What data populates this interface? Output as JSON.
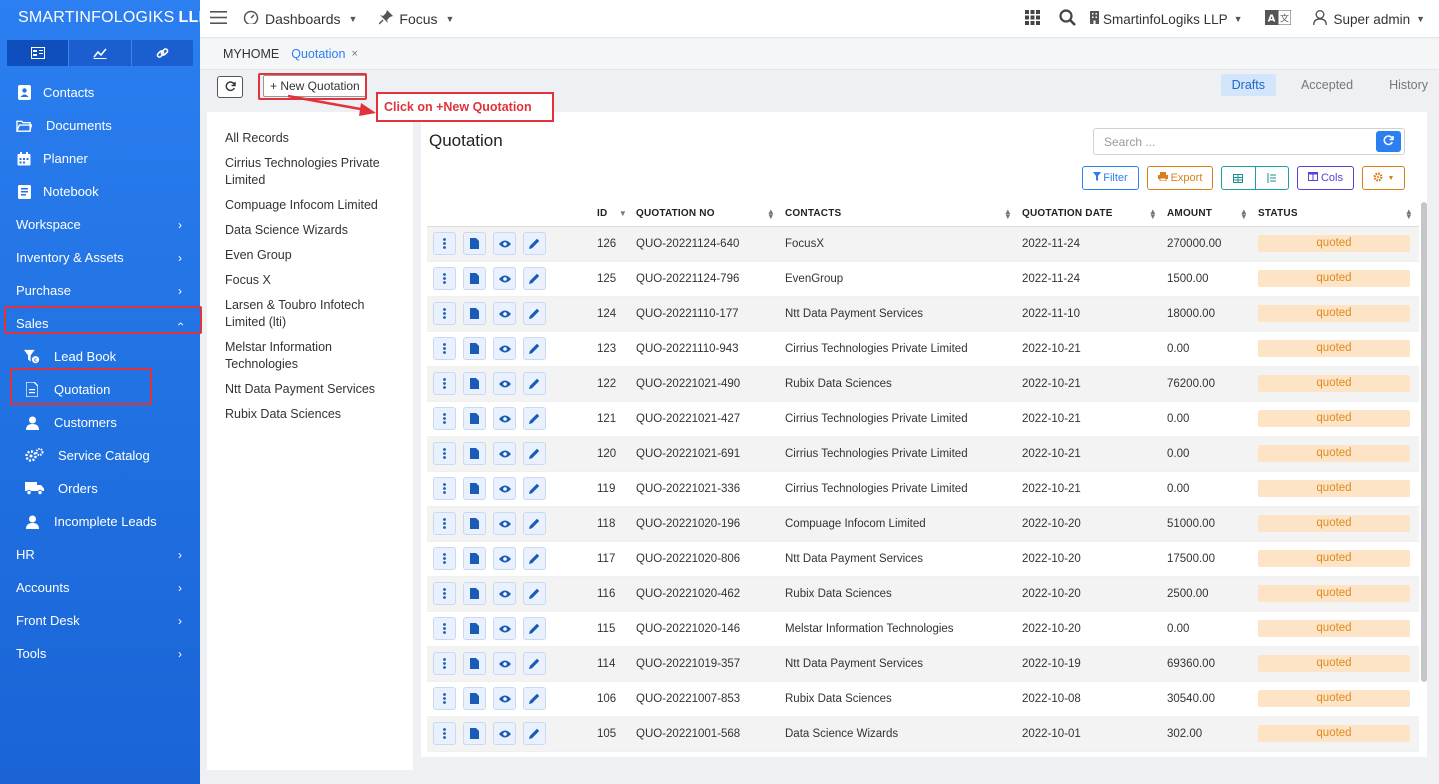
{
  "brand": {
    "name": "SMARTINFOLOGIKS",
    "suffix": "LLP"
  },
  "sidebar": {
    "items": [
      {
        "label": "Contacts",
        "icon": "contact-icon"
      },
      {
        "label": "Documents",
        "icon": "folder-icon"
      },
      {
        "label": "Planner",
        "icon": "calendar-icon"
      },
      {
        "label": "Notebook",
        "icon": "notebook-icon"
      },
      {
        "label": "Workspace",
        "icon": ""
      },
      {
        "label": "Inventory & Assets",
        "icon": ""
      },
      {
        "label": "Purchase",
        "icon": ""
      },
      {
        "label": "Sales",
        "icon": ""
      }
    ],
    "sales_sub": [
      {
        "label": "Lead Book",
        "icon": "lead-filter-icon"
      },
      {
        "label": "Quotation",
        "icon": "document-icon"
      },
      {
        "label": "Customers",
        "icon": "user-icon"
      },
      {
        "label": "Service Catalog",
        "icon": "gears-icon"
      },
      {
        "label": "Orders",
        "icon": "truck-icon"
      },
      {
        "label": "Incomplete Leads",
        "icon": "user-icon"
      }
    ],
    "bottom": [
      {
        "label": "HR"
      },
      {
        "label": "Accounts"
      },
      {
        "label": "Front Desk"
      },
      {
        "label": "Tools"
      }
    ]
  },
  "topbar": {
    "dashboards": "Dashboards",
    "focus": "Focus",
    "company": "SmartinfoLogiks LLP",
    "user": "Super admin"
  },
  "breadcrumb": {
    "home": "MYHOME",
    "current": "Quotation",
    "close": "×"
  },
  "actions": {
    "new_label": "+ New Quotation"
  },
  "tabs": [
    "Drafts",
    "Accepted",
    "History"
  ],
  "callout": "Click on +New Quotation",
  "filters": [
    "All Records",
    "Cirrius Technologies Private Limited",
    "Compuage Infocom Limited",
    "Data Science Wizards",
    "Even Group",
    "Focus X",
    "Larsen & Toubro Infotech Limited (lti)",
    "Melstar Information Technologies",
    "Ntt Data Payment Services",
    "Rubix Data Sciences"
  ],
  "main": {
    "title": "Quotation",
    "search_placeholder": "Search ...",
    "buttons": {
      "filter": "Filter",
      "export": "Export",
      "cols": "Cols"
    }
  },
  "table": {
    "headers": [
      "ID",
      "QUOTATION NO",
      "CONTACTS",
      "QUOTATION DATE",
      "AMOUNT",
      "STATUS"
    ],
    "rows": [
      [
        "126",
        "QUO-20221124-640",
        "FocusX",
        "2022-11-24",
        "270000.00",
        "quoted"
      ],
      [
        "125",
        "QUO-20221124-796",
        "EvenGroup",
        "2022-11-24",
        "1500.00",
        "quoted"
      ],
      [
        "124",
        "QUO-20221110-177",
        "Ntt Data Payment Services",
        "2022-11-10",
        "18000.00",
        "quoted"
      ],
      [
        "123",
        "QUO-20221110-943",
        "Cirrius Technologies Private Limited",
        "2022-10-21",
        "0.00",
        "quoted"
      ],
      [
        "122",
        "QUO-20221021-490",
        "Rubix Data Sciences",
        "2022-10-21",
        "76200.00",
        "quoted"
      ],
      [
        "121",
        "QUO-20221021-427",
        "Cirrius Technologies Private Limited",
        "2022-10-21",
        "0.00",
        "quoted"
      ],
      [
        "120",
        "QUO-20221021-691",
        "Cirrius Technologies Private Limited",
        "2022-10-21",
        "0.00",
        "quoted"
      ],
      [
        "119",
        "QUO-20221021-336",
        "Cirrius Technologies Private Limited",
        "2022-10-21",
        "0.00",
        "quoted"
      ],
      [
        "118",
        "QUO-20221020-196",
        "Compuage Infocom Limited",
        "2022-10-20",
        "51000.00",
        "quoted"
      ],
      [
        "117",
        "QUO-20221020-806",
        "Ntt Data Payment Services",
        "2022-10-20",
        "17500.00",
        "quoted"
      ],
      [
        "116",
        "QUO-20221020-462",
        "Rubix Data Sciences",
        "2022-10-20",
        "2500.00",
        "quoted"
      ],
      [
        "115",
        "QUO-20221020-146",
        "Melstar Information Technologies",
        "2022-10-20",
        "0.00",
        "quoted"
      ],
      [
        "114",
        "QUO-20221019-357",
        "Ntt Data Payment Services",
        "2022-10-19",
        "69360.00",
        "quoted"
      ],
      [
        "106",
        "QUO-20221007-853",
        "Rubix Data Sciences",
        "2022-10-08",
        "30540.00",
        "quoted"
      ],
      [
        "105",
        "QUO-20221001-568",
        "Data Science Wizards",
        "2022-10-01",
        "302.00",
        "quoted"
      ]
    ]
  },
  "colors": {
    "accent": "#2b7ff0",
    "highlight": "#e0333c",
    "status_bg": "#fde4c6",
    "status_text": "#e08a1e"
  }
}
